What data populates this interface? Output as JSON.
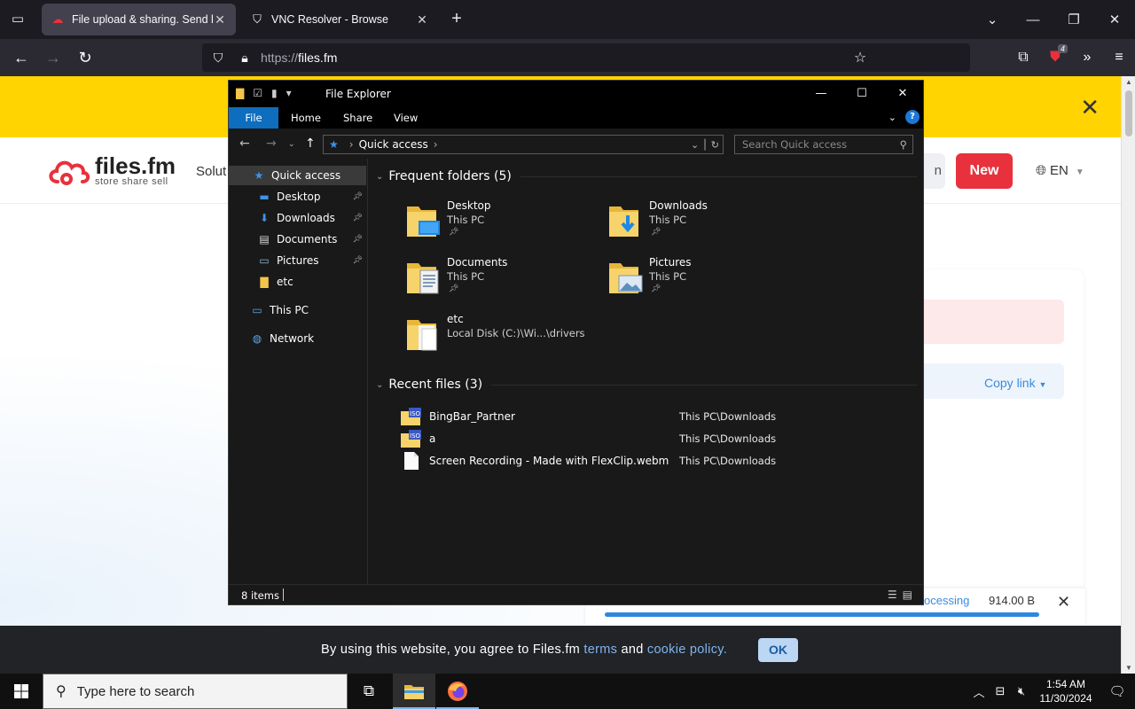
{
  "browser": {
    "tabs": [
      {
        "title": "File upload & sharing. Send large files",
        "active": true
      },
      {
        "title": "VNC Resolver - Browse",
        "active": false
      }
    ],
    "url_proto": "https://",
    "url_host": "files.fm",
    "ublock_count": "4"
  },
  "site": {
    "logo_main": "files.fm",
    "logo_tagline": "store share sell",
    "nav_solutions": "Solut",
    "login_label": "n",
    "new_label": "New",
    "lang_label": "EN",
    "copy_link": "Copy link",
    "upload_status": "ocessing",
    "upload_size": "914.00 B",
    "upload_progress": 1.0,
    "cookie_prefix": "By using this website, you agree to Files.fm ",
    "cookie_terms": "terms",
    "cookie_and": " and ",
    "cookie_policy": "cookie policy.",
    "cookie_ok": "OK",
    "accent_red": "#e8313c",
    "banner_yellow": "#ffd400"
  },
  "explorer": {
    "title": "File Explorer",
    "ribbon": {
      "file": "File",
      "home": "Home",
      "share": "Share",
      "view": "View"
    },
    "address": "Quick access",
    "search_placeholder": "Search Quick access",
    "nav": {
      "quick_access": "Quick access",
      "desktop": "Desktop",
      "downloads": "Downloads",
      "documents": "Documents",
      "pictures": "Pictures",
      "etc": "etc",
      "this_pc": "This PC",
      "network": "Network"
    },
    "frequent_header": "Frequent folders (5)",
    "folders": [
      {
        "name": "Desktop",
        "location": "This PC",
        "icon": "desktop-folder-icon"
      },
      {
        "name": "Downloads",
        "location": "This PC",
        "icon": "downloads-folder-icon"
      },
      {
        "name": "Documents",
        "location": "This PC",
        "icon": "documents-folder-icon"
      },
      {
        "name": "Pictures",
        "location": "This PC",
        "icon": "pictures-folder-icon"
      },
      {
        "name": "etc",
        "location": "Local Disk (C:)\\Wi...\\drivers",
        "icon": "etc-folder-icon"
      }
    ],
    "recent_header": "Recent files (3)",
    "recent": [
      {
        "name": "BingBar_Partner",
        "location": "This PC\\Downloads",
        "icon": "iso-file-icon"
      },
      {
        "name": "a",
        "location": "This PC\\Downloads",
        "icon": "iso-file-icon"
      },
      {
        "name": "Screen Recording - Made with FlexClip.webm",
        "location": "This PC\\Downloads",
        "icon": "blank-file-icon"
      }
    ],
    "status_count": "8 items"
  },
  "taskbar": {
    "search_placeholder": "Type here to search",
    "time": "1:54 AM",
    "date": "11/30/2024"
  }
}
